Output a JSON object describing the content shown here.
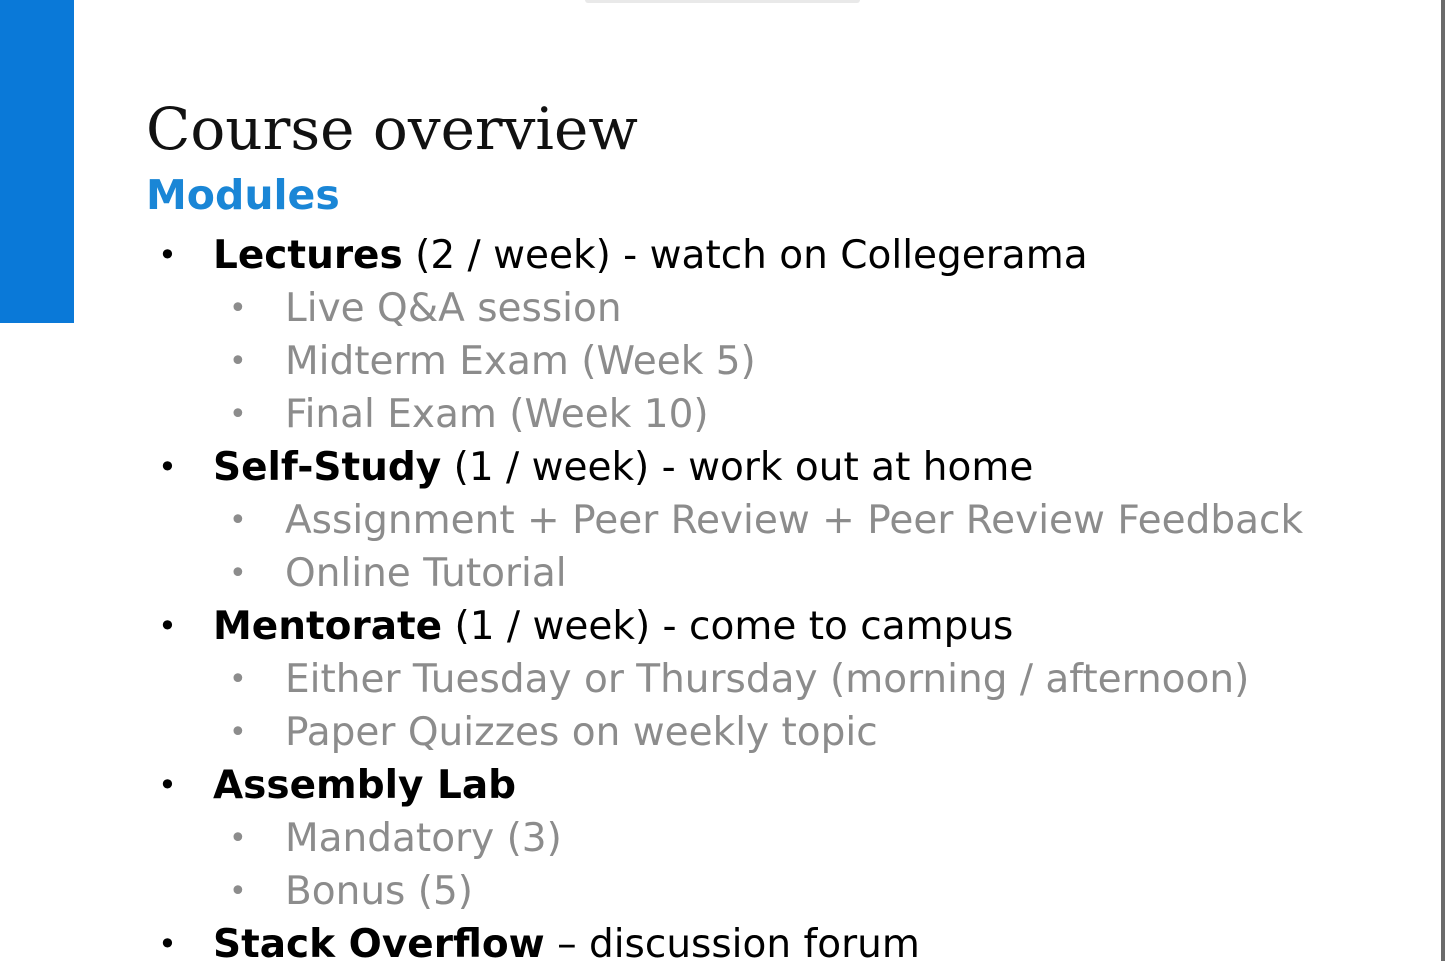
{
  "slide": {
    "title": "Course overview",
    "subtitle": "Modules",
    "accent_color": "#0a79d8",
    "subtitle_color": "#1a86d6",
    "sub_item_color": "#8c8c8c",
    "bullet_glyph": "•",
    "items": [
      {
        "level": 1,
        "bold": "Lectures",
        "rest": " (2 / week) - watch on Collegerama"
      },
      {
        "level": 2,
        "text": "Live Q&A session"
      },
      {
        "level": 2,
        "text": "Midterm Exam (Week 5)"
      },
      {
        "level": 2,
        "text": "Final Exam (Week 10)"
      },
      {
        "level": 1,
        "bold": "Self-Study",
        "rest": " (1 / week) - work out at home"
      },
      {
        "level": 2,
        "text": "Assignment + Peer Review + Peer Review Feedback"
      },
      {
        "level": 2,
        "text": "Online Tutorial"
      },
      {
        "level": 1,
        "bold": "Mentorate",
        "rest": " (1 / week) - come to campus"
      },
      {
        "level": 2,
        "text": "Either Tuesday or Thursday (morning / afternoon)"
      },
      {
        "level": 2,
        "text": "Paper Quizzes on weekly topic"
      },
      {
        "level": 1,
        "bold": "Assembly Lab",
        "rest": ""
      },
      {
        "level": 2,
        "text": "Mandatory (3)"
      },
      {
        "level": 2,
        "text": "Bonus (5)"
      },
      {
        "level": 1,
        "bold": "Stack Overflow",
        "rest": " – discussion forum"
      }
    ]
  }
}
